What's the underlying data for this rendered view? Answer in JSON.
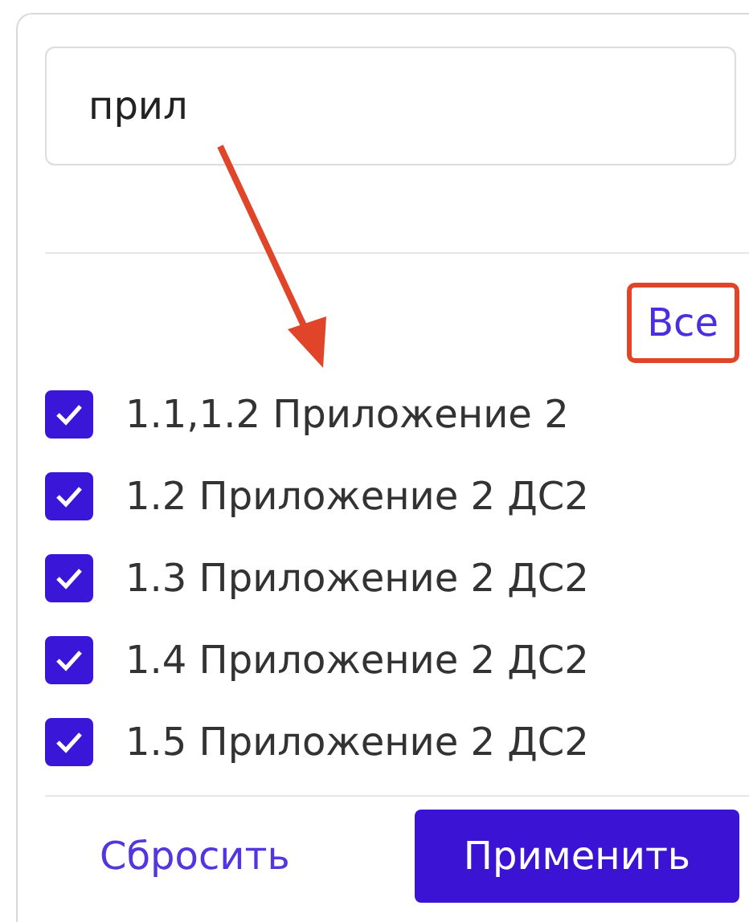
{
  "search": {
    "value": "прил"
  },
  "annotation": {
    "kind": "arrow"
  },
  "select_all": {
    "label": "Все",
    "highlighted": true
  },
  "items": [
    {
      "label": "1.1,1.2 Приложение 2",
      "checked": true
    },
    {
      "label": "1.2 Приложение 2 ДС2",
      "checked": true
    },
    {
      "label": "1.3 Приложение 2 ДС2",
      "checked": true
    },
    {
      "label": "1.4 Приложение 2 ДС2",
      "checked": true
    },
    {
      "label": "1.5 Приложение 2 ДС2",
      "checked": true
    }
  ],
  "buttons": {
    "reset": "Сбросить",
    "apply": "Применить"
  }
}
